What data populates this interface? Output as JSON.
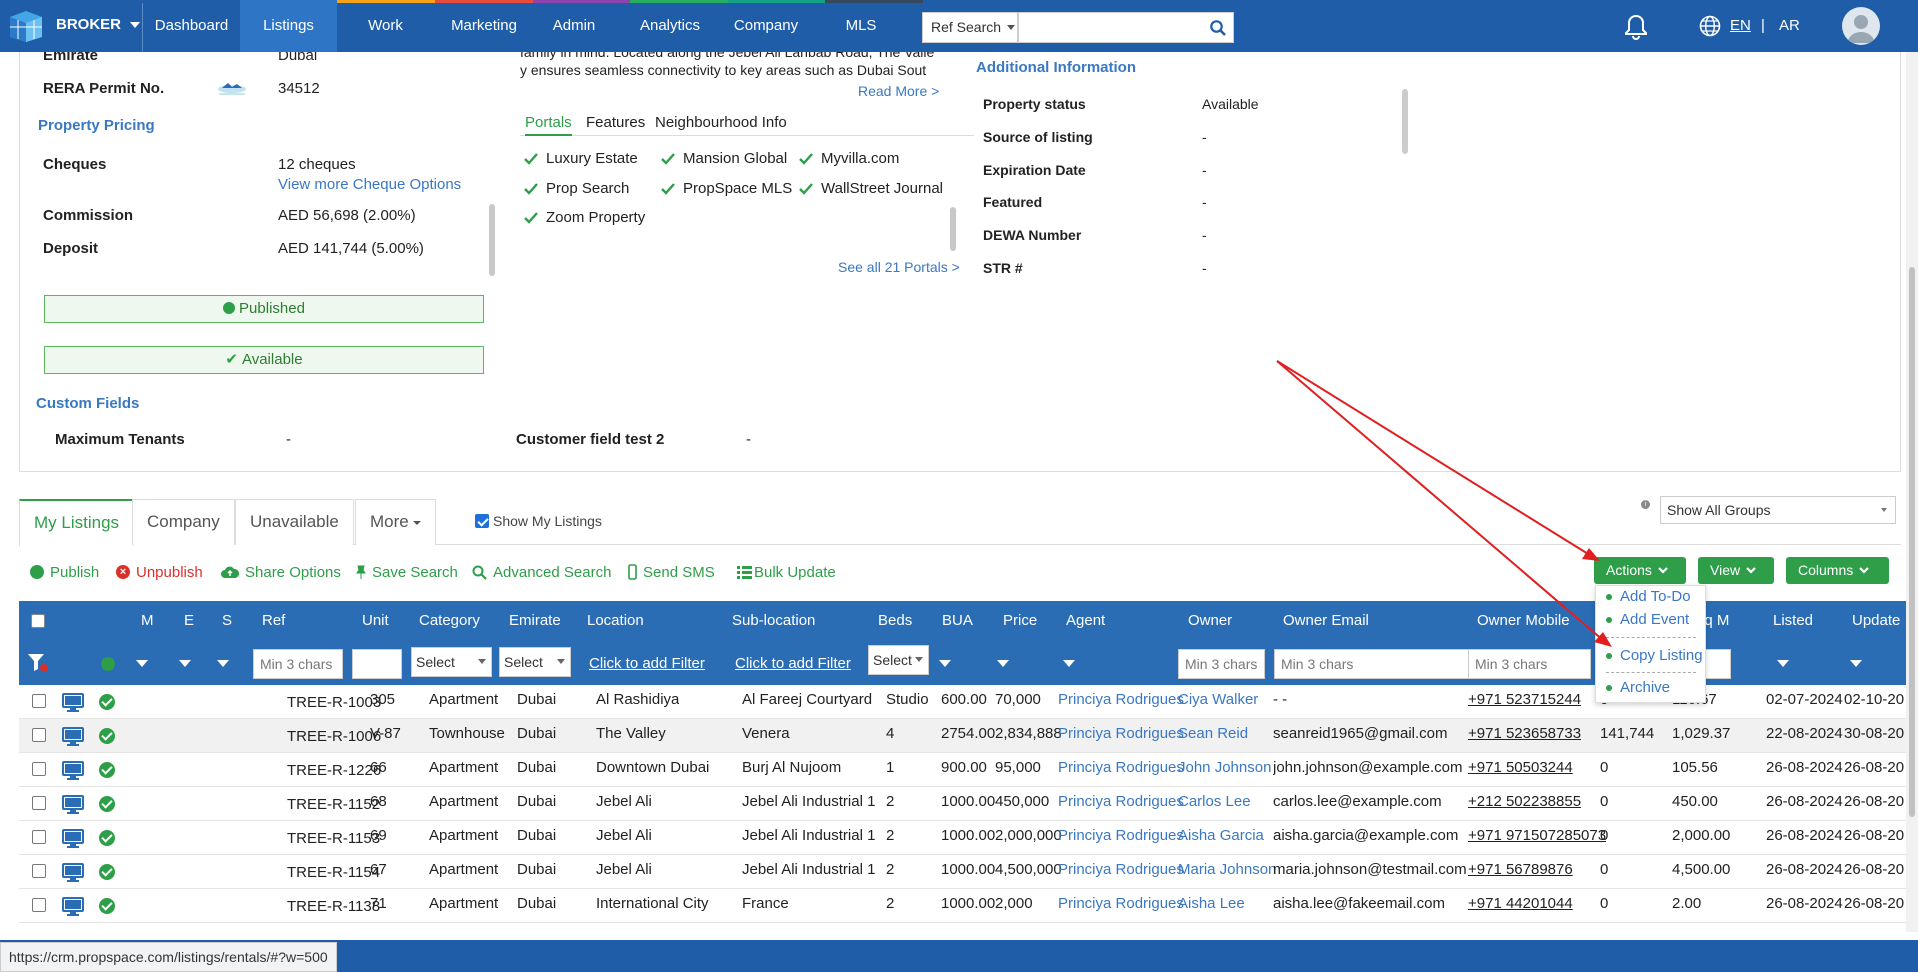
{
  "app": {
    "brand": "BROKER",
    "nav": [
      "Dashboard",
      "Listings",
      "Work",
      "Marketing",
      "Admin",
      "Analytics",
      "Company",
      "MLS"
    ],
    "active_nav": "Listings",
    "ref_search_label": "Ref Search",
    "search_value": "",
    "lang_en": "EN",
    "lang_sep": "|",
    "lang_ar": "AR"
  },
  "details": {
    "emirate_label": "Emirate",
    "emirate_value": "Dubai",
    "rera_label": "RERA Permit No.",
    "rera_value": "34512",
    "pricing_title": "Property Pricing",
    "cheques_label": "Cheques",
    "cheques_value": "12 cheques",
    "cheques_link": "View more Cheque Options",
    "commission_label": "Commission",
    "commission_value": "AED 56,698 (2.00%)",
    "deposit_label": "Deposit",
    "deposit_value": "AED 141,744 (5.00%)",
    "published": "Published",
    "available": "Available",
    "custom_title": "Custom Fields",
    "max_tenants_label": "Maximum Tenants",
    "max_tenants_value": "-",
    "customer_field_label": "Customer field test 2",
    "customer_field_value": "-",
    "desc_line1": "family in mind. Located along the Jebel Ali Lahbab Road, The Valle",
    "desc_line2": "y ensures seamless connectivity to key areas such as Dubai Sout",
    "read_more": "Read More >",
    "portal_tabs": [
      "Portals",
      "Features",
      "Neighbourhood Info"
    ],
    "portals": [
      "Luxury Estate",
      "Mansion Global",
      "Myvilla.com",
      "Prop Search",
      "PropSpace MLS",
      "WallStreet Journal",
      "Zoom Property"
    ],
    "see_all": "See all 21 Portals >",
    "additional_title": "Additional Information",
    "additional": [
      {
        "label": "Property status",
        "value": "Available"
      },
      {
        "label": "Source of listing",
        "value": "-"
      },
      {
        "label": "Expiration Date",
        "value": "-"
      },
      {
        "label": "Featured",
        "value": "-"
      },
      {
        "label": "DEWA Number",
        "value": "-"
      },
      {
        "label": "STR #",
        "value": "-"
      }
    ]
  },
  "listings": {
    "tabs": [
      "My Listings",
      "Company",
      "Unavailable",
      "More"
    ],
    "show_my": "Show My Listings",
    "groups": "Show All Groups",
    "toolbar": {
      "publish": "Publish",
      "unpublish": "Unpublish",
      "share": "Share Options",
      "save_search": "Save Search",
      "advanced": "Advanced Search",
      "sms": "Send SMS",
      "bulk": "Bulk Update"
    },
    "buttons": {
      "actions": "Actions",
      "view": "View",
      "columns": "Columns"
    },
    "actions_menu": [
      "Add To-Do",
      "Add Event",
      "Copy Listing",
      "Archive"
    ],
    "columns": [
      "M",
      "E",
      "S",
      "Ref",
      "Unit",
      "Category",
      "Emirate",
      "Location",
      "Sub-location",
      "Beds",
      "BUA",
      "Price",
      "Agent",
      "Owner",
      "Owner Email",
      "Owner Mobile",
      "/ Sq M",
      "Listed",
      "Update"
    ],
    "filters": {
      "min3": "Min 3 chars",
      "select": "Select",
      "click_filter": "Click to add Filter"
    },
    "rows": [
      {
        "ref": "TREE-R-1003",
        "unit": "305",
        "category": "Apartment",
        "emirate": "Dubai",
        "location": "Al Rashidiya",
        "sub": "Al Fareej Courtyard",
        "beds": "Studio",
        "bua": "600.00",
        "price": "70,000",
        "agent": "Princiya Rodrigues",
        "owner": "Ciya Walker",
        "email": "- -",
        "mobile": "+971 523715244",
        "c1": "0",
        "sqm": "116.67",
        "listed": "02-07-2024",
        "updated": "02-10-20"
      },
      {
        "ref": "TREE-R-1006",
        "unit": "V-87",
        "category": "Townhouse",
        "emirate": "Dubai",
        "location": "The Valley",
        "sub": "Venera",
        "beds": "4",
        "bua": "2754.00",
        "price": "2,834,888",
        "agent": "Princiya Rodrigues",
        "owner": "Sean Reid",
        "email": "seanreid1965@gmail.com",
        "mobile": "+971 523658733",
        "c1": "141,744",
        "sqm": "1,029.37",
        "listed": "22-08-2024",
        "updated": "30-08-20"
      },
      {
        "ref": "TREE-R-1226",
        "unit": "66",
        "category": "Apartment",
        "emirate": "Dubai",
        "location": "Downtown Dubai",
        "sub": "Burj Al Nujoom",
        "beds": "1",
        "bua": "900.00",
        "price": "95,000",
        "agent": "Princiya Rodrigues",
        "owner": "John Johnson",
        "email": "john.johnson@example.com",
        "mobile": "+971 50503244",
        "c1": "0",
        "sqm": "105.56",
        "listed": "26-08-2024",
        "updated": "26-08-20"
      },
      {
        "ref": "TREE-R-1152",
        "unit": "68",
        "category": "Apartment",
        "emirate": "Dubai",
        "location": "Jebel Ali",
        "sub": "Jebel Ali Industrial 1",
        "beds": "2",
        "bua": "1000.00",
        "price": "450,000",
        "agent": "Princiya Rodrigues",
        "owner": "Carlos Lee",
        "email": "carlos.lee@example.com",
        "mobile": "+212 502238855",
        "c1": "0",
        "sqm": "450.00",
        "listed": "26-08-2024",
        "updated": "26-08-20"
      },
      {
        "ref": "TREE-R-1153",
        "unit": "69",
        "category": "Apartment",
        "emirate": "Dubai",
        "location": "Jebel Ali",
        "sub": "Jebel Ali Industrial 1",
        "beds": "2",
        "bua": "1000.00",
        "price": "2,000,000",
        "agent": "Princiya Rodrigues",
        "owner": "Aisha Garcia",
        "email": "aisha.garcia@example.com",
        "mobile": "+971 971507285073",
        "c1": "0",
        "sqm": "2,000.00",
        "listed": "26-08-2024",
        "updated": "26-08-20"
      },
      {
        "ref": "TREE-R-1154",
        "unit": "67",
        "category": "Apartment",
        "emirate": "Dubai",
        "location": "Jebel Ali",
        "sub": "Jebel Ali Industrial 1",
        "beds": "2",
        "bua": "1000.00",
        "price": "4,500,000",
        "agent": "Princiya Rodrigues",
        "owner": "Maria Johnson",
        "email": "maria.johnson@testmail.com",
        "mobile": "+971 56789876",
        "c1": "0",
        "sqm": "4,500.00",
        "listed": "26-08-2024",
        "updated": "26-08-20"
      },
      {
        "ref": "TREE-R-1138",
        "unit": "71",
        "category": "Apartment",
        "emirate": "Dubai",
        "location": "International City",
        "sub": "France",
        "beds": "2",
        "bua": "1000.00",
        "price": "2,000",
        "agent": "Princiya Rodrigues",
        "owner": "Aisha Lee",
        "email": "aisha.lee@fakeemail.com",
        "mobile": "+971 44201044",
        "c1": "0",
        "sqm": "2.00",
        "listed": "26-08-2024",
        "updated": "26-08-20"
      }
    ]
  },
  "statusbar": {
    "url": "https://crm.propspace.com/listings/rentals/#?w=500"
  },
  "colors": {
    "nav": "#1f5da8",
    "header": "#2a6db5",
    "green": "#2e9e49",
    "link": "#3a78c2",
    "red": "#d9302b",
    "annotation": "#e02020"
  },
  "icons": [
    "logo-icon",
    "caret-icon",
    "search-icon",
    "bell-icon",
    "globe-icon",
    "avatar-icon",
    "rera-logo-icon",
    "check-icon",
    "info-icon",
    "pin-icon",
    "cloud-upload-icon",
    "mobile-icon",
    "list-icon",
    "filter-icon",
    "monitor-icon",
    "check-circle-icon",
    "chevron-down-icon"
  ]
}
